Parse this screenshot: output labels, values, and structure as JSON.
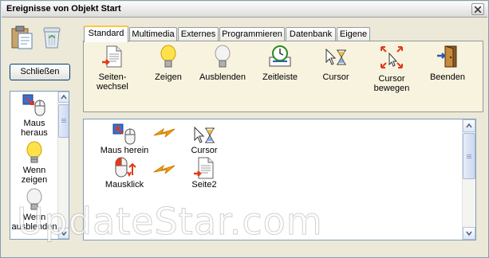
{
  "window": {
    "title": "Ereignisse von Objekt Start"
  },
  "left_tools": {
    "icons": [
      "clipboard-icon",
      "trash-icon"
    ]
  },
  "close_button": {
    "label": "Schließen"
  },
  "left_list": {
    "items": [
      {
        "label": "Maus heraus",
        "icon": "mouse-out-icon"
      },
      {
        "label": "Wenn zeigen",
        "icon": "lightbulb-on-icon"
      },
      {
        "label": "Wenn ausblenden",
        "icon": "lightbulb-off-icon"
      }
    ]
  },
  "tabs": [
    "Standard",
    "Multimedia",
    "Externes",
    "Programmieren",
    "Datenbank",
    "Eigene"
  ],
  "active_tab": "Standard",
  "toolbar": {
    "items": [
      {
        "label": "Seiten-\nwechsel",
        "icon": "page-change-icon"
      },
      {
        "label": "Zeigen",
        "icon": "lightbulb-on-icon"
      },
      {
        "label": "Ausblenden",
        "icon": "lightbulb-off-icon"
      },
      {
        "label": "Zeitleiste",
        "icon": "timeline-icon"
      },
      {
        "label": "Cursor",
        "icon": "cursor-hourglass-icon"
      },
      {
        "label": "Cursor\nbewegen",
        "icon": "cursor-move-icon"
      },
      {
        "label": "Beenden",
        "icon": "exit-door-icon"
      }
    ]
  },
  "events": {
    "rows": [
      {
        "trigger": "Maus herein",
        "action": "Cursor"
      },
      {
        "trigger": "Mausklick",
        "action": "Seite2"
      }
    ]
  },
  "watermark": "UpdateStar.com",
  "colors": {
    "active_tab_accent": "#ffc83c",
    "panel_bg": "#f8f3df",
    "bolt": "#f5a000"
  }
}
